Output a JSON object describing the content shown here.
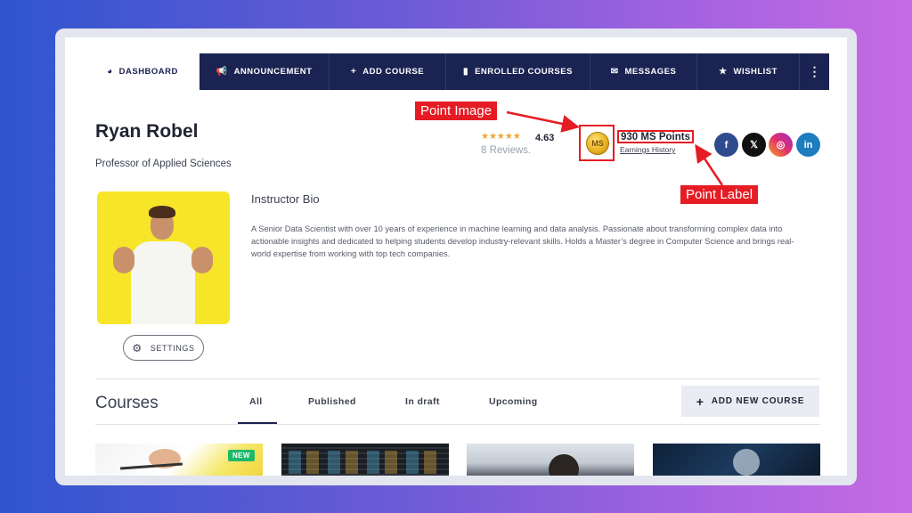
{
  "nav": {
    "items": [
      {
        "label": "DASHBOARD",
        "icon": "dashboard-icon",
        "active": true
      },
      {
        "label": "ANNOUNCEMENT",
        "icon": "megaphone-icon"
      },
      {
        "label": "ADD COURSE",
        "icon": "plus-icon"
      },
      {
        "label": "ENROLLED COURSES",
        "icon": "book-icon"
      },
      {
        "label": "MESSAGES",
        "icon": "envelope-icon"
      },
      {
        "label": "WISHLIST",
        "icon": "star-icon"
      }
    ],
    "more_icon": "vertical-dots-icon"
  },
  "profile": {
    "name": "Ryan Robel",
    "title": "Professor of Applied Sciences",
    "rating": "4.63",
    "rating_stars": 4.63,
    "reviews": "8 Reviews.",
    "points_label": "930 MS Points",
    "earnings_link": "Earnings History",
    "coin_text": "MS"
  },
  "social": [
    {
      "name": "facebook",
      "glyph": "f"
    },
    {
      "name": "x",
      "glyph": "𝕏"
    },
    {
      "name": "instagram",
      "glyph": "◎"
    },
    {
      "name": "linkedin",
      "glyph": "in"
    }
  ],
  "annotations": {
    "point_image": "Point Image",
    "point_label": "Point Label"
  },
  "bio": {
    "heading": "Instructor Bio",
    "text": "A Senior Data Scientist with over 10 years of experience in machine learning and data analysis. Passionate about transforming complex data into actionable insights and dedicated to helping students develop industry-relevant skills. Holds a Master’s degree in Computer Science and brings real-world expertise from working with top tech companies."
  },
  "settings_label": "SETTINGS",
  "courses": {
    "heading": "Courses",
    "tabs": [
      "All",
      "Published",
      "In draft",
      "Upcoming"
    ],
    "active_tab": "All",
    "add_button": "ADD NEW COURSE",
    "badge_new": "NEW"
  },
  "colors": {
    "nav_bg": "#1b2352",
    "accent_red": "#e61c24",
    "badge_green": "#1fb86a",
    "star_orange": "#f0a52a"
  }
}
